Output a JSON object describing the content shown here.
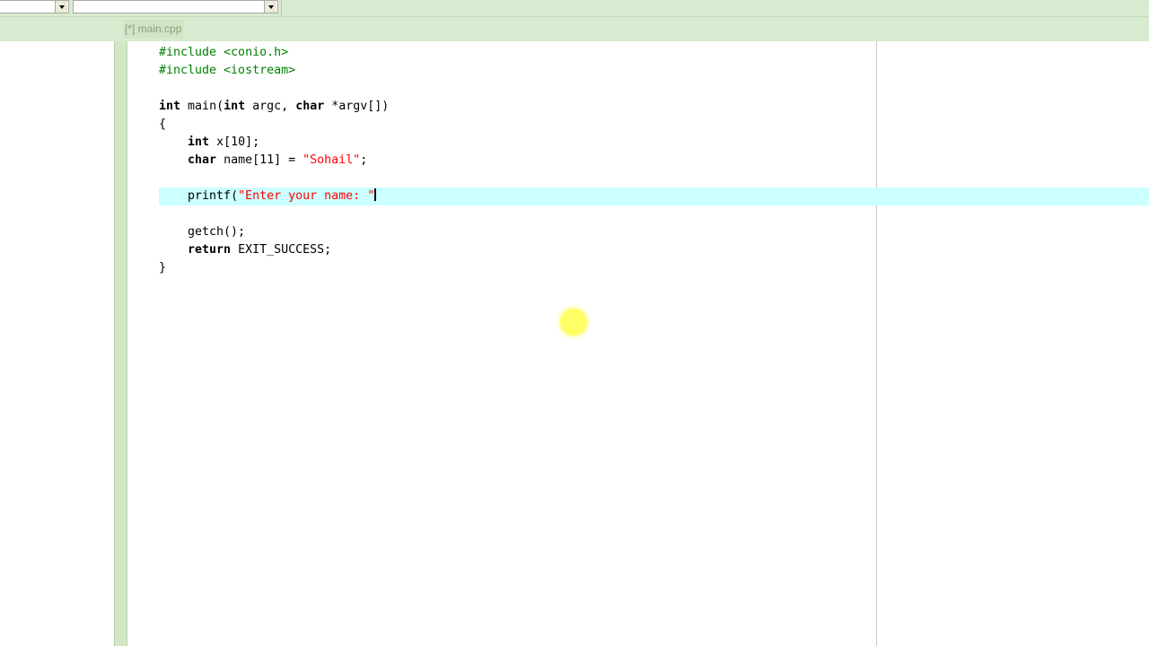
{
  "toolbar": {
    "combo1_value": "",
    "combo2_value": ""
  },
  "tabs": [
    {
      "label": "[*] main.cpp",
      "active": true
    }
  ],
  "editor": {
    "lines": [
      "#include <conio.h>",
      "#include <iostream>",
      "",
      "int main(int argc, char *argv[])",
      "{",
      "    int x[10];",
      "    char name[11] = \"Sohail\";",
      "",
      "    printf(\"Enter your name: \"",
      "",
      "    getch();",
      "    return EXIT_SUCCESS;",
      "}"
    ],
    "active_line": 9,
    "highlight_color": "#ccffff",
    "string_color": "#ff0000",
    "preprocessor_color": "#008000"
  },
  "colors": {
    "chrome_green": "#d8ead0",
    "gutter_green": "#d2e7c6",
    "cursor_highlight": "#ffff55"
  }
}
